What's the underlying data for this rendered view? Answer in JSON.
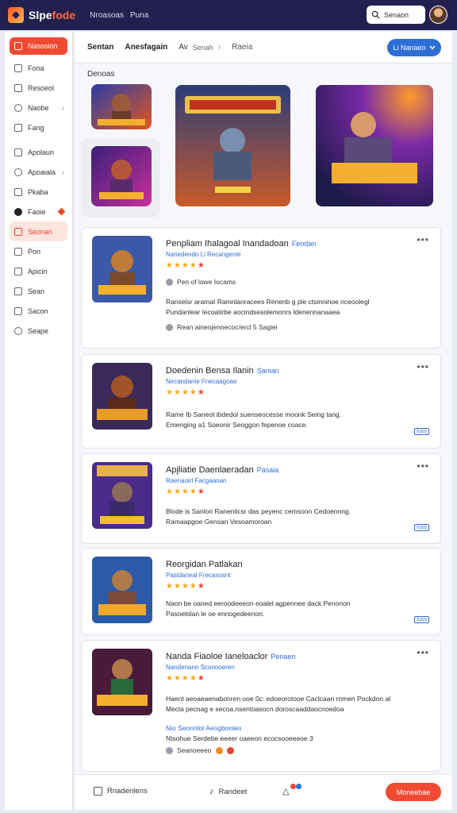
{
  "app": {
    "brand_main": "Slpe",
    "brand_accent": "fode",
    "nav": [
      "Nroasoas",
      "Puna"
    ]
  },
  "header": {
    "search_label": "Senaon"
  },
  "sidebar": {
    "items": [
      {
        "label": "Nasosion",
        "icon": "home-icon"
      },
      {
        "label": "Fona",
        "icon": "list-icon"
      },
      {
        "label": "Resoeol",
        "icon": "list-icon"
      },
      {
        "label": "Naobe",
        "icon": "circle-icon"
      },
      {
        "label": "Fang",
        "icon": "image-icon"
      },
      {
        "label": "Apolaun",
        "icon": "file-icon"
      },
      {
        "label": "Apoaiala",
        "icon": "globe-icon"
      },
      {
        "label": "Pkaba",
        "icon": "box-icon"
      },
      {
        "label": "Faoie",
        "icon": "user-icon"
      },
      {
        "label": "Seonan",
        "icon": "star-icon"
      },
      {
        "label": "Pon",
        "icon": "file-icon"
      },
      {
        "label": "Apicin",
        "icon": "edit-icon"
      },
      {
        "label": "Sean",
        "icon": "grid-icon"
      },
      {
        "label": "Sacon",
        "icon": "list-icon"
      },
      {
        "label": "Seape",
        "icon": "settings-icon"
      }
    ]
  },
  "tabs": {
    "t1": "Sentan",
    "t2": "Anesfagain",
    "t3": "Av",
    "search": "Senah",
    "t4": "Raeia",
    "filter": "Li Nanaeo"
  },
  "section": {
    "label": "Denoas"
  },
  "cards": [
    {
      "title": "Penpliam Ihalagoal Inandadoan",
      "tag": "Fendan",
      "subtitle": "Nanedendo Li Recangenie",
      "meta1": "Pen of lowe Iocams",
      "desc1": "Ranselsr aramat Ramnlanracees Renenb g ple ctsinninoe nceoolegl",
      "desc2": "Pundanlear lecoatirbe aocindsesolemonrs ldenennanaaea",
      "meta2": "Rean aineojennecoc/ercl 5 Sagiei"
    },
    {
      "title": "Doedenin Bensa Ilanin",
      "tag": "Sanian",
      "subtitle": "Necandanie Fnecaagoae",
      "desc1": "Rame Ib Saneot ibdedol suenseocesse moonk Seing tang.",
      "desc2": "Emenging a1 Soeonir  Seoggon fepenoe coace.",
      "ver": "Iuss"
    },
    {
      "title": "Apjliatie Daenlaeradan",
      "tag": "Pasaia",
      "subtitle": "Raenaoirl Facgaaoan",
      "desc1": "Blode is Sanlori Ranenlicsr das peyenc cemsoon Cedoennng.",
      "desc2": "Ramaapgoe Gensan  Vesoamoroan",
      "ver": "Iuss"
    },
    {
      "title": "Reorgidan Patlakan",
      "tag": "",
      "subtitle": "Pasidaneal Frecasosnt",
      "desc1": "Naon be oaned eeroodeeeon eoalel agpennee dack Penonon",
      "desc2": "Pasoelolan le oe ennogedeenon.",
      "ver": "Iuss"
    },
    {
      "title": "Nanda Fiaoloe Ianeloaclor",
      "tag": "Penaen",
      "subtitle": "Nandenane Sconooeren",
      "desc1": "Haent aeoaeaenabonren ooe 0c: edoeorotooe Caclcaan rnmen Pockdon al",
      "desc2": "Mecla pecnag e secoa.nsentoasocn doroscaaddaocnoedoa",
      "desc3": "Nio Seonnlol Aeogbonleo",
      "desc4": "Ntsohue Serdebe eeeer oaeeon ecocsooeeeoe 3",
      "meta2": "Seanoeeeo"
    }
  ],
  "bottom": {
    "b1": "Rnadenlens",
    "b2": "Randeet",
    "cta": "Moneebae"
  }
}
